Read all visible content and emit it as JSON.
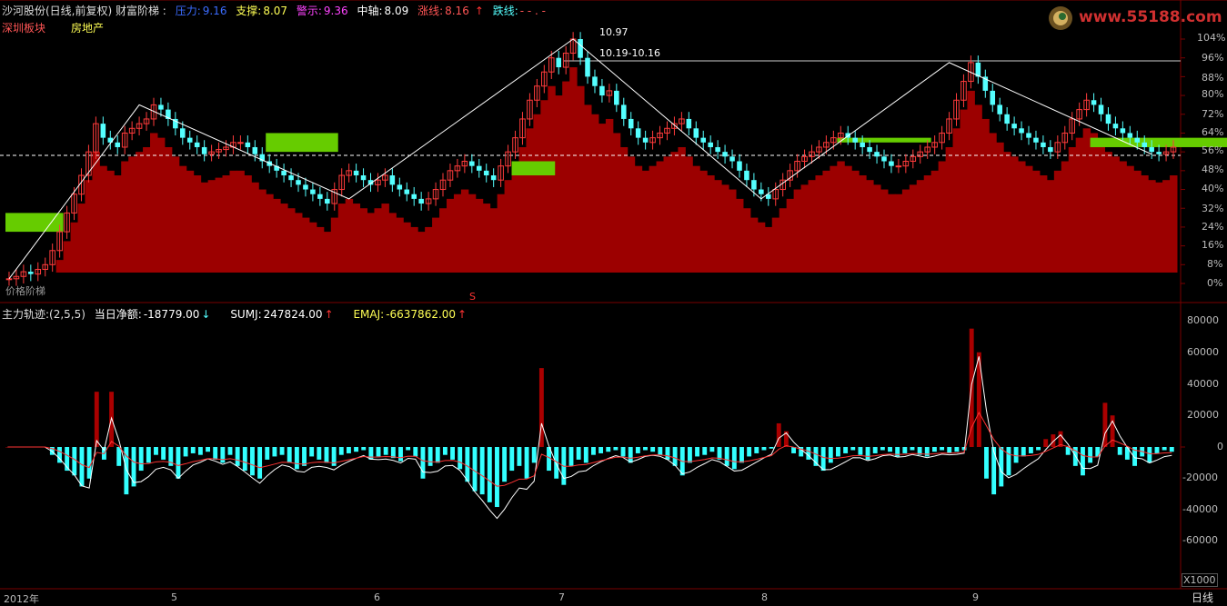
{
  "header": {
    "title": "沙河股份(日线,前复权) 财富阶梯 :",
    "pressure_label": "压力:",
    "pressure_value": "9.16",
    "support_label": "支撑:",
    "support_value": "8.07",
    "alert_label": "警示:",
    "alert_value": "9.36",
    "axis_label": "中轴:",
    "axis_value": "8.09",
    "up_label": "涨线:",
    "up_value": "8.16",
    "down_label": "跌线:",
    "down_value": "- - . -"
  },
  "tags": {
    "region": "深圳板块",
    "sector": "房地产"
  },
  "watermark": "www.55188.com",
  "peak_annotations": {
    "high": "10.97",
    "range": "10.19-10.16"
  },
  "legend_bottom_left": "价格阶梯",
  "marker_s": "S",
  "indicator": {
    "title": "主力轨迹:(2,5,5)",
    "net_label": "当日净额:",
    "net_value": "-18779.00",
    "sumj_label": "SUMJ:",
    "sumj_value": "247824.00",
    "emaj_label": "EMAJ:",
    "emaj_value": "-6637862.00"
  },
  "x_axis": {
    "year": "2012年",
    "months": [
      "5",
      "6",
      "7",
      "8",
      "9"
    ],
    "period_button": "日线"
  },
  "upper_axis_ticks": [
    "104%",
    "96%",
    "88%",
    "80%",
    "72%",
    "64%",
    "56%",
    "48%",
    "40%",
    "32%",
    "24%",
    "16%",
    "8%",
    "0%"
  ],
  "lower_axis_ticks": [
    "80000",
    "60000",
    "40000",
    "20000",
    "0",
    "-20000",
    "-40000",
    "-60000"
  ],
  "lower_unit": "X1000",
  "colors": {
    "up": "#ff3b3b",
    "down": "#54ffff",
    "ladder_red": "#9c0000",
    "ladder_green": "#66cc00",
    "grid": "#7a0000",
    "white": "#ffffff"
  },
  "chart_data": {
    "type": "candlestick",
    "price_axis_percent": [
      0,
      8,
      16,
      24,
      32,
      40,
      48,
      56,
      64,
      72,
      80,
      88,
      96,
      104
    ],
    "close_percent": [
      2,
      3,
      5,
      4,
      6,
      8,
      14,
      22,
      30,
      38,
      46,
      56,
      68,
      62,
      60,
      58,
      64,
      66,
      68,
      70,
      76,
      74,
      70,
      66,
      62,
      60,
      58,
      55,
      56,
      57,
      58,
      60,
      60,
      58,
      55,
      52,
      50,
      48,
      46,
      44,
      42,
      40,
      38,
      36,
      34,
      40,
      46,
      48,
      46,
      44,
      42,
      44,
      46,
      42,
      40,
      38,
      36,
      34,
      36,
      40,
      44,
      48,
      50,
      52,
      50,
      48,
      46,
      44,
      50,
      56,
      62,
      70,
      78,
      84,
      90,
      96,
      92,
      98,
      104,
      96,
      88,
      84,
      80,
      82,
      76,
      70,
      66,
      62,
      60,
      62,
      64,
      66,
      68,
      70,
      66,
      62,
      60,
      58,
      56,
      54,
      52,
      48,
      44,
      40,
      38,
      36,
      40,
      44,
      48,
      52,
      54,
      56,
      58,
      60,
      62,
      64,
      62,
      60,
      58,
      56,
      54,
      52,
      50,
      50,
      52,
      54,
      56,
      58,
      60,
      64,
      70,
      78,
      86,
      94,
      88,
      82,
      76,
      72,
      68,
      66,
      64,
      62,
      60,
      58,
      56,
      60,
      64,
      70,
      74,
      78,
      76,
      72,
      68,
      66,
      64,
      62,
      60,
      58,
      56,
      55,
      56,
      58
    ],
    "net_flow_thousands": [
      0,
      0,
      0,
      0,
      0,
      0,
      -5,
      -10,
      -15,
      -18,
      -25,
      -20,
      35,
      -8,
      35,
      -12,
      -30,
      -25,
      -15,
      -10,
      -5,
      -8,
      -12,
      -20,
      -6,
      -4,
      -5,
      -3,
      -8,
      -10,
      -5,
      -12,
      -15,
      -18,
      -20,
      -8,
      -6,
      -5,
      -10,
      -14,
      -12,
      -6,
      -8,
      -10,
      -12,
      -5,
      -4,
      -3,
      -2,
      -8,
      -6,
      -5,
      -7,
      -9,
      -2,
      -6,
      -20,
      -12,
      -10,
      -5,
      -8,
      -14,
      -22,
      -28,
      -30,
      -35,
      -38,
      -22,
      -15,
      -12,
      -20,
      -10,
      50,
      -15,
      -20,
      -24,
      -12,
      -8,
      -10,
      -5,
      -4,
      -3,
      -2,
      -6,
      -10,
      -4,
      -2,
      -3,
      -5,
      -8,
      -12,
      -18,
      -10,
      -6,
      -5,
      -3,
      -8,
      -12,
      -14,
      -10,
      -6,
      -4,
      -2,
      -1,
      15,
      10,
      -4,
      -6,
      -8,
      -12,
      -15,
      -10,
      -6,
      -4,
      -2,
      -5,
      -8,
      -4,
      -2,
      -3,
      -6,
      -4,
      -2,
      -5,
      -6,
      -3,
      -2,
      -4,
      -3,
      -2,
      75,
      60,
      -20,
      -30,
      -25,
      -18,
      -10,
      -6,
      -4,
      -2,
      5,
      8,
      10,
      -5,
      -12,
      -18,
      -10,
      -6,
      28,
      20,
      -5,
      -8,
      -12,
      -6,
      -10,
      -4,
      -2,
      -3
    ]
  }
}
